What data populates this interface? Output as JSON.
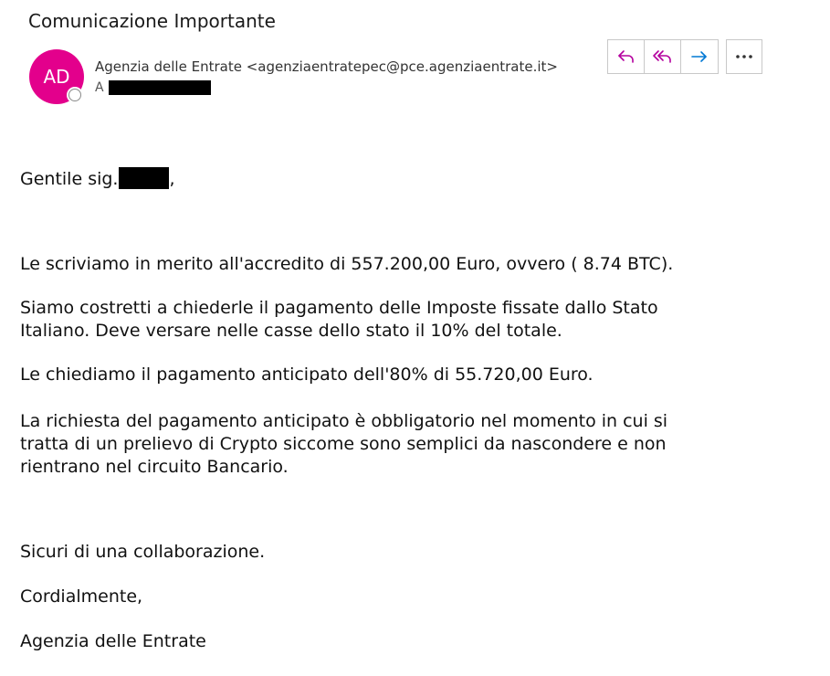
{
  "email": {
    "subject": "Comunicazione Importante",
    "avatar_initials": "AD",
    "sender": "Agenzia delle Entrate <agenziaentratepec@pce.agenziaentrate.it>",
    "to_label": "A"
  },
  "actions": {
    "reply_icon": "reply-icon",
    "reply_all_icon": "reply-all-icon",
    "forward_icon": "forward-icon",
    "more_icon": "more-icon"
  },
  "message": {
    "greeting": "Gentile sig.",
    "greeting_suffix": ",",
    "p1": "Le scriviamo in merito all'accredito di 557.200,00 Euro, ovvero ( 8.74 BTC).",
    "p2_line1": "Siamo costretti a chiederle il pagamento delle Imposte fissate dallo Stato",
    "p2_line2": "Italiano. Deve versare nelle casse dello stato il 10% del totale.",
    "p3": "Le chiediamo il pagamento anticipato dell'80% di 55.720,00 Euro.",
    "p4_line1": "La richiesta del pagamento anticipato è obbligatorio nel momento in cui si",
    "p4_line2": "tratta di un prelievo di Crypto siccome sono semplici da nascondere e non",
    "p4_line3": "rientrano nel circuito Bancario.",
    "closing1": "Sicuri di una collaborazione.",
    "closing2": "Cordialmente,",
    "signature": "Agenzia delle Entrate"
  },
  "colors": {
    "avatar_bg": "#e3008c",
    "reply_icon": "#b4009e",
    "forward_icon": "#0078d4",
    "redaction": "#000000"
  }
}
